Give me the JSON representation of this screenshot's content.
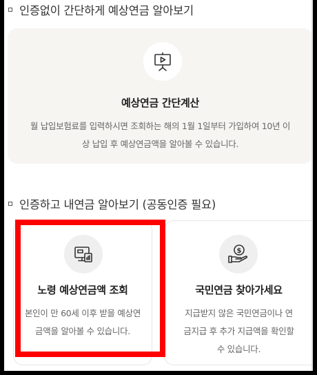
{
  "sections": {
    "simple": {
      "heading": "인증없이 간단하게 예상연금 알아보기",
      "card": {
        "icon": "presentation-board-icon",
        "title": "예상연금 간단계산",
        "desc_line1": "월 납입보험료를 입력하시면 조회하는 해의 1월 1일부터 가입하여 10년 이",
        "desc_line2": "상 납입 후 예상연금액을 알아볼 수 있습니다."
      }
    },
    "certified": {
      "heading": "인증하고 내연금 알아보기 (공동인증 필요)",
      "cards": [
        {
          "icon": "monitor-chart-icon",
          "title": "노령 예상연금액 조회",
          "desc_line1": "본인이 만 60세 이후 받을 예상연",
          "desc_line2": "금액을 알아볼 수 있습니다."
        },
        {
          "icon": "hand-coin-icon",
          "title": "국민연금 찾아가세요",
          "desc_line1": "지급받지 않은 국민연금이나 연",
          "desc_line2": "금지급 후 추가 지급액을 확인할",
          "desc_line3": "수 있습니다."
        }
      ]
    }
  },
  "colors": {
    "highlight": "#ff0000",
    "card_bg": "#f7f5f2",
    "icon_stroke": "#333333"
  }
}
